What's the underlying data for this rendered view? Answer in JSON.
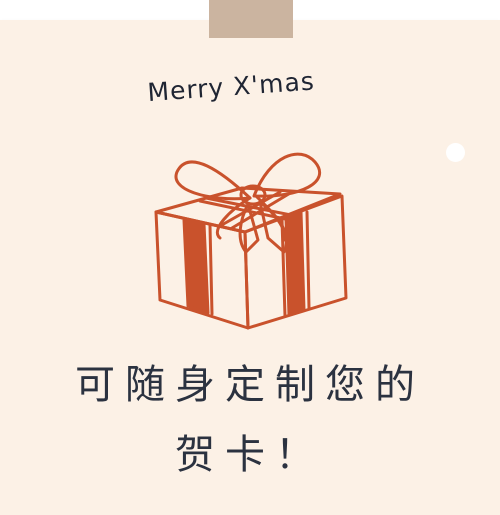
{
  "card": {
    "greeting": "Merry X'mas",
    "message_line_1": "可随身定制您的",
    "message_line_2": "贺卡！"
  },
  "icons": {
    "gift": "gift-box-icon",
    "tape": "tape-strip",
    "hole": "pin-hole"
  },
  "colors": {
    "background": "#fcf1e6",
    "tape": "#c8b09b",
    "gift_stroke": "#c9522c",
    "text": "#2b3240"
  }
}
